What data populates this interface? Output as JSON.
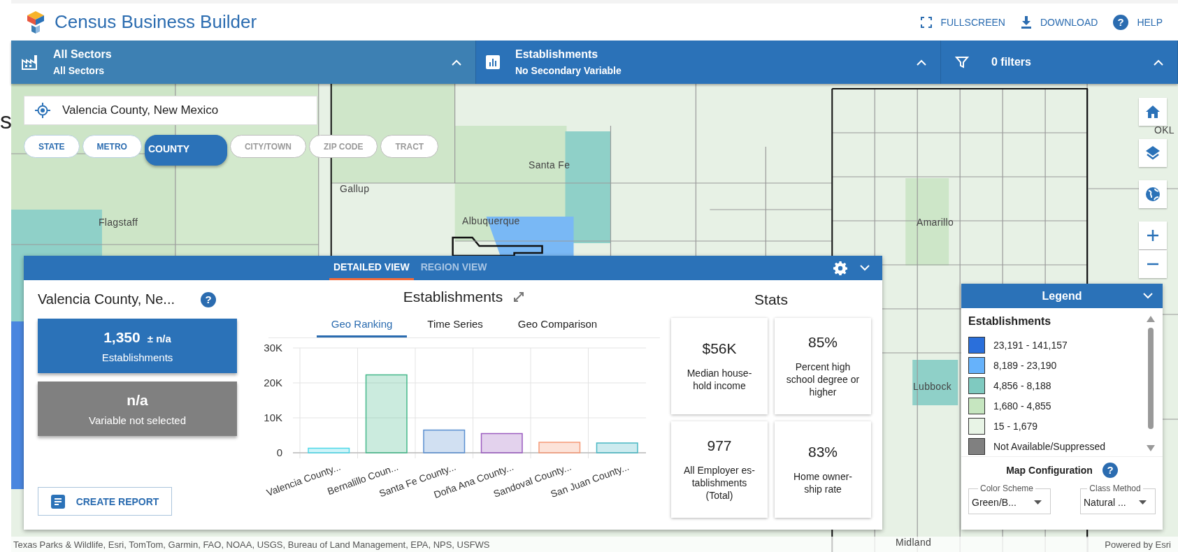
{
  "edge_text": "s",
  "header": {
    "title": "Census Business Builder",
    "actions": [
      {
        "kind": "fullscreen",
        "label": "FULLSCREEN"
      },
      {
        "kind": "download",
        "label": "DOWNLOAD"
      },
      {
        "kind": "help",
        "label": "HELP",
        "glyph": "?"
      }
    ]
  },
  "toolbar": [
    {
      "kind": "sector",
      "title": "All Sectors",
      "subtitle": "All Sectors"
    },
    {
      "kind": "variable",
      "title": "Establishments",
      "subtitle": "No Secondary Variable"
    },
    {
      "kind": "filter",
      "title": "0 filters"
    }
  ],
  "map": {
    "search_value": "Valencia County, New Mexico",
    "geo_levels": [
      {
        "label": "STATE",
        "selected": false,
        "disabled": false
      },
      {
        "label": "METRO",
        "selected": false,
        "disabled": false
      },
      {
        "label": "COUNTY",
        "selected": true,
        "disabled": false
      },
      {
        "label": "CITY/TOWN",
        "selected": false,
        "disabled": true
      },
      {
        "label": "ZIP CODE",
        "selected": false,
        "disabled": true
      },
      {
        "label": "TRACT",
        "selected": false,
        "disabled": true
      }
    ],
    "places": [
      "Flagstaff",
      "Gallup",
      "Santa Fe",
      "Albuquerque",
      "Amarillo",
      "Lubbock",
      "Midland",
      "OKL"
    ],
    "attribution": "Texas Parks & Wildlife, Esri, TomTom, Garmin, FAO, NOAA, USGS, Bureau of Land Management, EPA, NPS, USFWS",
    "powered_by": "Powered by Esri"
  },
  "panel": {
    "views": [
      {
        "label": "DETAILED VIEW",
        "selected": true
      },
      {
        "label": "REGION VIEW",
        "selected": false
      }
    ],
    "region_title": "Valencia County, Ne...",
    "help_glyph": "?",
    "primary": {
      "value": "1,350",
      "margin": "± n/a",
      "label": "Establishments"
    },
    "secondary": {
      "value": "n/a",
      "label": "Variable not selected"
    },
    "report_button": "CREATE REPORT",
    "chart_title": "Establishments",
    "chart_tabs": [
      {
        "label": "Geo Ranking",
        "selected": true
      },
      {
        "label": "Time Series",
        "selected": false
      },
      {
        "label": "Geo Comparison",
        "selected": false
      }
    ],
    "chart_data": {
      "type": "bar",
      "categories": [
        "Valencia County...",
        "Bernalillo Coun...",
        "Santa Fe County...",
        "Doña Ana County...",
        "Sandoval County...",
        "San Juan County..."
      ],
      "values": [
        1300,
        22300,
        6500,
        5500,
        3000,
        2800
      ],
      "colors": [
        "#4fd8e8",
        "#44b88a",
        "#5a8fd0",
        "#9b5cc0",
        "#f59a78",
        "#4ab8c4"
      ],
      "ylim": [
        0,
        30000
      ],
      "yticks": [
        {
          "value": 0,
          "label": "0"
        },
        {
          "value": 10000,
          "label": "10K"
        },
        {
          "value": 20000,
          "label": "20K"
        },
        {
          "value": 30000,
          "label": "30K"
        }
      ]
    },
    "stats_title": "Stats",
    "stats": [
      {
        "value": "$56K",
        "label": "Median house- hold income"
      },
      {
        "value": "85%",
        "label": "Percent high school degree or higher"
      },
      {
        "value": "977",
        "label": "All Employer es- tablishments (Total)"
      },
      {
        "value": "83%",
        "label": "Home owner- ship rate"
      }
    ]
  },
  "legend": {
    "title": "Legend",
    "variable": "Establishments",
    "items": [
      {
        "label": "23,191 - 141,157",
        "color": "#2a6fdb"
      },
      {
        "label": "8,189 - 23,190",
        "color": "#66b2fb"
      },
      {
        "label": "4,856 - 8,188",
        "color": "#7fcac0"
      },
      {
        "label": "1,680 - 4,855",
        "color": "#c6e6c0"
      },
      {
        "label": "15 - 1,679",
        "color": "#e8f4e6"
      },
      {
        "label": "Not Available/Suppressed",
        "color": "#808080"
      }
    ],
    "config_title": "Map Configuration",
    "help_glyph": "?",
    "selects": [
      {
        "label": "Color Scheme",
        "value": "Green/B..."
      },
      {
        "label": "Class Method",
        "value": "Natural ..."
      }
    ]
  }
}
